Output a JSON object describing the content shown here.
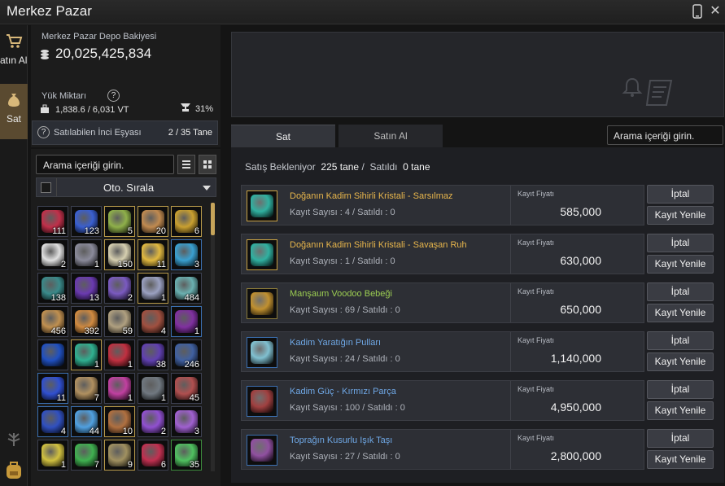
{
  "window": {
    "title": "Merkez Pazar"
  },
  "nav": {
    "buy_label": "Satın Al",
    "sell_label": "Sat"
  },
  "depot": {
    "balance_label": "Merkez Pazar Depo Bakiyesi",
    "balance": "20,025,425,834",
    "weight_label": "Yük Miktarı",
    "weight_value": "1,838.6 / 6,031 VT",
    "weight_percent": "31%"
  },
  "sellable": {
    "label": "Satılabilen İnci Eşyası",
    "count": "2 / 35 Tane"
  },
  "inventory": {
    "search_placeholder": "Arama içeriği girin.",
    "sort_label": "Oto. Sırala",
    "slots": [
      {
        "count": "111",
        "color": "#c0304a",
        "border": ""
      },
      {
        "count": "123",
        "color": "#3a5fd0",
        "border": ""
      },
      {
        "count": "5",
        "color": "#8fb04a",
        "border": "gold"
      },
      {
        "count": "20",
        "color": "#c08a50",
        "border": "gold"
      },
      {
        "count": "6",
        "color": "#c9a030",
        "border": "gold"
      },
      {
        "count": "2",
        "color": "#e0e0e0",
        "border": ""
      },
      {
        "count": "1",
        "color": "#8a8a9a",
        "border": ""
      },
      {
        "count": "150",
        "color": "#d6cfb0",
        "border": "gold"
      },
      {
        "count": "11",
        "color": "#e0b840",
        "border": "gold"
      },
      {
        "count": "3",
        "color": "#3aa0d0",
        "border": "blue"
      },
      {
        "count": "138",
        "color": "#3a8a8a",
        "border": ""
      },
      {
        "count": "13",
        "color": "#6a3ab0",
        "border": ""
      },
      {
        "count": "2",
        "color": "#7a5ac0",
        "border": ""
      },
      {
        "count": "1",
        "color": "#9aa0c0",
        "border": "gold"
      },
      {
        "count": "484",
        "color": "#6ab0b0",
        "border": ""
      },
      {
        "count": "456",
        "color": "#c09050",
        "border": ""
      },
      {
        "count": "392",
        "color": "#d08a40",
        "border": ""
      },
      {
        "count": "59",
        "color": "#b0a080",
        "border": ""
      },
      {
        "count": "4",
        "color": "#a05040",
        "border": ""
      },
      {
        "count": "1",
        "color": "#8030a0",
        "border": "blue"
      },
      {
        "count": "",
        "color": "#2050c0",
        "border": ""
      },
      {
        "count": "1",
        "color": "#30b090",
        "border": "gold"
      },
      {
        "count": "1",
        "color": "#c03040",
        "border": ""
      },
      {
        "count": "38",
        "color": "#6040b0",
        "border": ""
      },
      {
        "count": "246",
        "color": "#4060a0",
        "border": ""
      },
      {
        "count": "11",
        "color": "#3050d0",
        "border": "blue"
      },
      {
        "count": "7",
        "color": "#b09060",
        "border": ""
      },
      {
        "count": "1",
        "color": "#c040a0",
        "border": ""
      },
      {
        "count": "1",
        "color": "#707880",
        "border": ""
      },
      {
        "count": "45",
        "color": "#b05050",
        "border": ""
      },
      {
        "count": "4",
        "color": "#3050c0",
        "border": "blue"
      },
      {
        "count": "44",
        "color": "#50a0e0",
        "border": "blue"
      },
      {
        "count": "10",
        "color": "#b07040",
        "border": "gold"
      },
      {
        "count": "2",
        "color": "#9050d0",
        "border": ""
      },
      {
        "count": "3",
        "color": "#a060d0",
        "border": ""
      },
      {
        "count": "1",
        "color": "#d0c040",
        "border": ""
      },
      {
        "count": "7",
        "color": "#40b050",
        "border": ""
      },
      {
        "count": "9",
        "color": "#a09060",
        "border": "gold"
      },
      {
        "count": "6",
        "color": "#c03050",
        "border": ""
      },
      {
        "count": "35",
        "color": "#50c060",
        "border": "green"
      }
    ]
  },
  "tabs": {
    "sell": "Sat",
    "buy": "Satın Al",
    "search_placeholder": "Arama içeriği girin."
  },
  "listing": {
    "waiting_label": "Satış Bekleniyor",
    "waiting_count": "225 tane",
    "sold_label": "Satıldı",
    "sold_count": "0 tane",
    "price_label": "Kayıt Fiyatı",
    "cancel_label": "İptal",
    "renew_label": "Kayıt Yenile",
    "items": [
      {
        "name": "Doğanın Kadim Sihirli Kristali - Sarsılmaz",
        "meta": "Kayıt Sayısı : 4 / Satıldı : 0",
        "price": "585,000",
        "name_color": "gold",
        "icon_color": "#30b0a0",
        "icon_border": "gold"
      },
      {
        "name": "Doğanın Kadim Sihirli Kristali - Savaşan Ruh",
        "meta": "Kayıt Sayısı : 1 / Satıldı : 0",
        "price": "630,000",
        "name_color": "gold",
        "icon_color": "#30b0a0",
        "icon_border": "gold"
      },
      {
        "name": "Manşaum Voodoo Bebeği",
        "meta": "Kayıt Sayısı : 69 / Satıldı : 0",
        "price": "650,000",
        "name_color": "green",
        "icon_color": "#c09030",
        "icon_border": ""
      },
      {
        "name": "Kadim Yaratığın Pulları",
        "meta": "Kayıt Sayısı : 24 / Satıldı : 0",
        "price": "1,140,000",
        "name_color": "blue",
        "icon_color": "#80c0d0",
        "icon_border": "blue"
      },
      {
        "name": "Kadim Güç - Kırmızı Parça",
        "meta": "Kayıt Sayısı : 100 / Satıldı : 0",
        "price": "4,950,000",
        "name_color": "blue",
        "icon_color": "#a04040",
        "icon_border": "blue"
      },
      {
        "name": "Toprağın Kusurlu Işık Taşı",
        "meta": "Kayıt Sayısı : 27 / Satıldı : 0",
        "price": "2,800,000",
        "name_color": "blue",
        "icon_color": "#9050a0",
        "icon_border": "blue"
      }
    ]
  }
}
